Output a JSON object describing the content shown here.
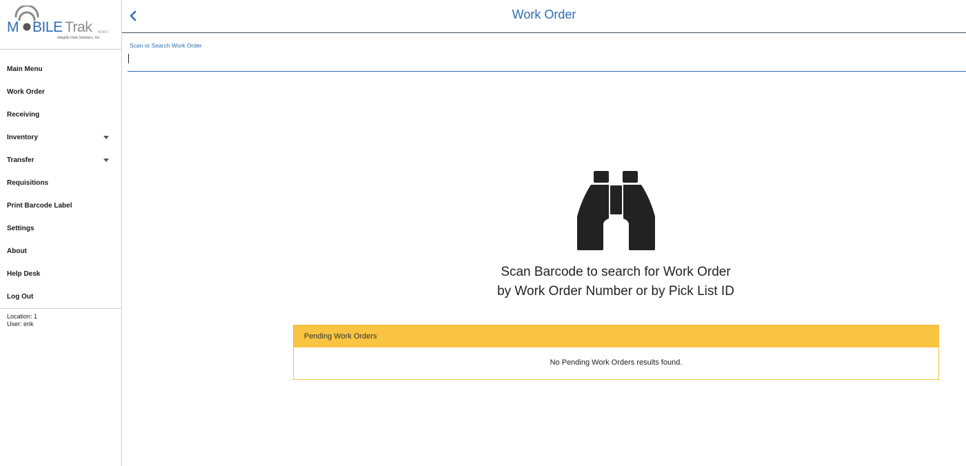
{
  "logo": {
    "brand": "M BILETrak",
    "suffix": "W.M.S",
    "company": "Integrity Data Solutions, Inc."
  },
  "sidebar": {
    "items": [
      {
        "label": "Main Menu"
      },
      {
        "label": "Work Order"
      },
      {
        "label": "Receiving"
      },
      {
        "label": "Inventory"
      },
      {
        "label": "Transfer"
      },
      {
        "label": "Requisitions"
      },
      {
        "label": "Print Barcode Label"
      },
      {
        "label": "Settings"
      },
      {
        "label": "About"
      },
      {
        "label": "Help Desk"
      },
      {
        "label": "Log Out"
      }
    ],
    "location": "Location: 1",
    "user": "User: erik"
  },
  "header": {
    "title": "Work Order",
    "back_icon": "chevron-left-icon"
  },
  "search": {
    "label": "Scan or Search Work Order",
    "value": "",
    "placeholder": ""
  },
  "empty_state": {
    "icon": "binoculars-icon",
    "line1": "Scan Barcode to search for Work Order",
    "line2": "by Work Order Number or by Pick List ID"
  },
  "pending": {
    "title": "Pending Work Orders",
    "message": "No Pending Work Orders results found."
  },
  "colors": {
    "accent": "#2f6db5",
    "panel_header": "#f8c441",
    "icon": "#222222"
  }
}
